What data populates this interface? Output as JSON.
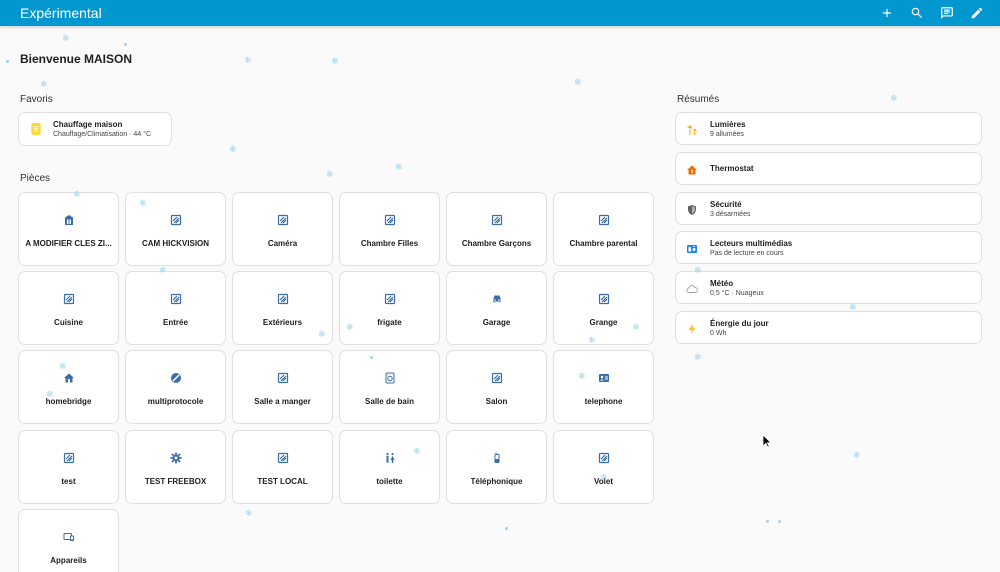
{
  "topbar": {
    "title": "Expérimental",
    "icons": [
      "plus-icon",
      "search-icon",
      "chat-icon",
      "pencil-icon"
    ]
  },
  "welcome": "Bienvenue MAISON",
  "favorites": {
    "title": "Favoris",
    "card": {
      "name": "Chauffage maison",
      "detail": "Chauffage/Climatisation · 44 °C",
      "icon": "thermostat-icon",
      "color": "#fdd835"
    }
  },
  "rooms": {
    "title": "Pièces",
    "items": [
      {
        "label": "A MODIFIER CLES ZI...",
        "icon": "safe-icon"
      },
      {
        "label": "CAM HICKVISION",
        "icon": "area-icon"
      },
      {
        "label": "Caméra",
        "icon": "area-icon"
      },
      {
        "label": "Chambre Filles",
        "icon": "area-icon"
      },
      {
        "label": "Chambre Garçons",
        "icon": "area-icon"
      },
      {
        "label": "Chambre parental",
        "icon": "area-icon"
      },
      {
        "label": "Cuisine",
        "icon": "area-icon"
      },
      {
        "label": "Entrée",
        "icon": "area-icon"
      },
      {
        "label": "Extérieurs",
        "icon": "area-icon"
      },
      {
        "label": "frigate",
        "icon": "area-icon"
      },
      {
        "label": "Garage",
        "icon": "car-icon"
      },
      {
        "label": "Grange",
        "icon": "area-icon"
      },
      {
        "label": "homebridge",
        "icon": "home-icon"
      },
      {
        "label": "multiprotocole",
        "icon": "slash-circle-icon"
      },
      {
        "label": "Salle a manger",
        "icon": "area-icon"
      },
      {
        "label": "Salle de bain",
        "icon": "washing-icon"
      },
      {
        "label": "Salon",
        "icon": "area-icon"
      },
      {
        "label": "telephone",
        "icon": "contact-card-icon"
      },
      {
        "label": "test",
        "icon": "area-icon"
      },
      {
        "label": "TEST FREEBOX",
        "icon": "gear-icon"
      },
      {
        "label": "TEST LOCAL",
        "icon": "area-icon"
      },
      {
        "label": "toilette",
        "icon": "restroom-icon"
      },
      {
        "label": "Téléphonique",
        "icon": "phone-icon"
      },
      {
        "label": "Volet",
        "icon": "area-icon"
      },
      {
        "label": "Appareils",
        "icon": "devices-icon"
      }
    ]
  },
  "summaries": {
    "title": "Résumés",
    "items": [
      {
        "name": "Lumières",
        "detail": "9 allumées",
        "icon": "lights-icon",
        "color": "#f9a825"
      },
      {
        "name": "Thermostat",
        "detail": "",
        "icon": "home-thermostat-icon",
        "color": "#ef6c00"
      },
      {
        "name": "Sécurité",
        "detail": "3 désarmées",
        "icon": "shield-icon",
        "color": "#616161"
      },
      {
        "name": "Lecteurs multimédias",
        "detail": "Pas de lecture en cours",
        "icon": "media-icon",
        "color": "#1e88e5"
      },
      {
        "name": "Météo",
        "detail": "0,5 °C · Nuageux",
        "icon": "cloud-icon",
        "color": "#9e9e9e"
      },
      {
        "name": "Énergie du jour",
        "detail": "0 Wh",
        "icon": "lightning-icon",
        "color": "#fbc02d"
      }
    ]
  },
  "colors": {
    "header": "#0397cf",
    "roomIcon": "#3a6ea5"
  }
}
